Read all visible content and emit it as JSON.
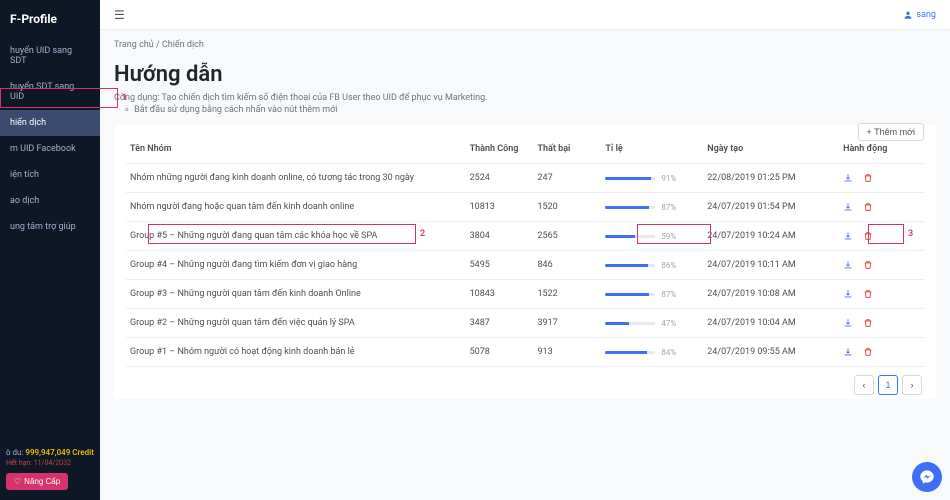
{
  "brand": "F-Profile",
  "sidebar": {
    "items": [
      {
        "label": "huyển UID sang SDT"
      },
      {
        "label": "huyển SDT sang UID"
      },
      {
        "label": "hiến dịch"
      },
      {
        "label": "m UID Facebook"
      },
      {
        "label": "iện tích"
      },
      {
        "label": "ao dịch"
      },
      {
        "label": "ung tâm trợ giúp"
      }
    ],
    "credit": {
      "prefix": "ò du:",
      "amount": "999,947,049 Credit"
    },
    "date": "Hết hạn: 11/04/2032",
    "upgrade": "Nâng Cấp"
  },
  "user": {
    "name": "sang"
  },
  "breadcrumb": {
    "home": "Trang chủ",
    "current": "Chiến dịch"
  },
  "pageTitle": "Hướng dẫn",
  "desc": {
    "line": "Công dụng: Tạo chiến dịch tìm kiếm số điện thoại của FB User theo UID để phục vụ Marketing.",
    "bullet": "Bắt đầu sử dụng bằng cách nhấn vào nút thêm mới"
  },
  "addBtn": "+  Thêm mới",
  "table": {
    "headers": {
      "name": "Tên Nhóm",
      "success": "Thành Công",
      "fail": "Thất bại",
      "rate": "Tỉ lệ",
      "date": "Ngày tạo",
      "action": "Hành động"
    },
    "rows": [
      {
        "name": "Nhóm những người đang kinh doanh online, có tương tác trong 30 ngày",
        "success": "2524",
        "fail": "247",
        "pct": 91,
        "date": "22/08/2019 01:25 PM"
      },
      {
        "name": "Nhóm người đang hoặc quan tâm đến kinh doanh online",
        "success": "10813",
        "fail": "1520",
        "pct": 87,
        "date": "24/07/2019 01:54 PM"
      },
      {
        "name": "Group #5 – Những người đang quan tâm các khóa học về SPA",
        "success": "3804",
        "fail": "2565",
        "pct": 59,
        "date": "24/07/2019 10:24 AM"
      },
      {
        "name": "Group #4 – Những người đang tìm kiếm đơn vị giao hàng",
        "success": "5495",
        "fail": "846",
        "pct": 86,
        "date": "24/07/2019 10:11 AM"
      },
      {
        "name": "Group #3 – Những người quan tâm đến kinh doanh Online",
        "success": "10843",
        "fail": "1522",
        "pct": 87,
        "date": "24/07/2019 10:08 AM"
      },
      {
        "name": "Group #2 – Những người quan tâm đến việc quản lý SPA",
        "success": "3487",
        "fail": "3917",
        "pct": 47,
        "date": "24/07/2019 10:04 AM"
      },
      {
        "name": "Group #1 – Nhóm người có hoạt động kinh doanh bán lẻ",
        "success": "5078",
        "fail": "913",
        "pct": 84,
        "date": "24/07/2019 09:55 AM"
      }
    ]
  },
  "pagination": {
    "page": "1"
  },
  "annotations": {
    "n1": "1",
    "n2": "2",
    "n3": "3"
  }
}
